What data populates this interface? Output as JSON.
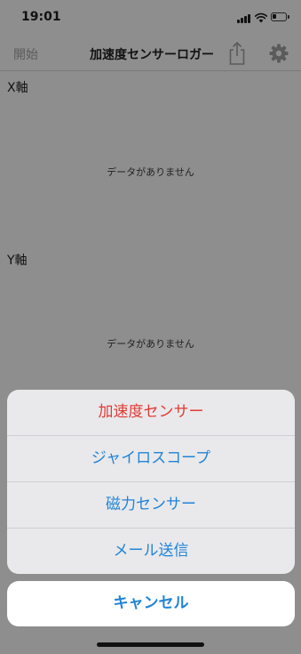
{
  "status_bar": {
    "time": "19:01",
    "battery_level": 0.3
  },
  "nav": {
    "start_label": "開始",
    "title": "加速度センサーロガー",
    "share_icon": "share-icon",
    "settings_icon": "gear-icon"
  },
  "content": {
    "x_axis_label": "X軸",
    "y_axis_label": "Y軸",
    "no_data_text": "データがありません"
  },
  "action_sheet": {
    "items": [
      {
        "label": "加速度センサー",
        "style": "destructive"
      },
      {
        "label": "ジャイロスコープ",
        "style": "default"
      },
      {
        "label": "磁力センサー",
        "style": "default"
      },
      {
        "label": "メール送信",
        "style": "default"
      }
    ],
    "cancel_label": "キャンセル"
  },
  "colors": {
    "dim_background": "#8e8e8e",
    "action_blue": "#1f83d8",
    "destructive_red": "#e23b35",
    "sheet_background": "#e9e9eb",
    "cancel_background": "#ffffff"
  }
}
